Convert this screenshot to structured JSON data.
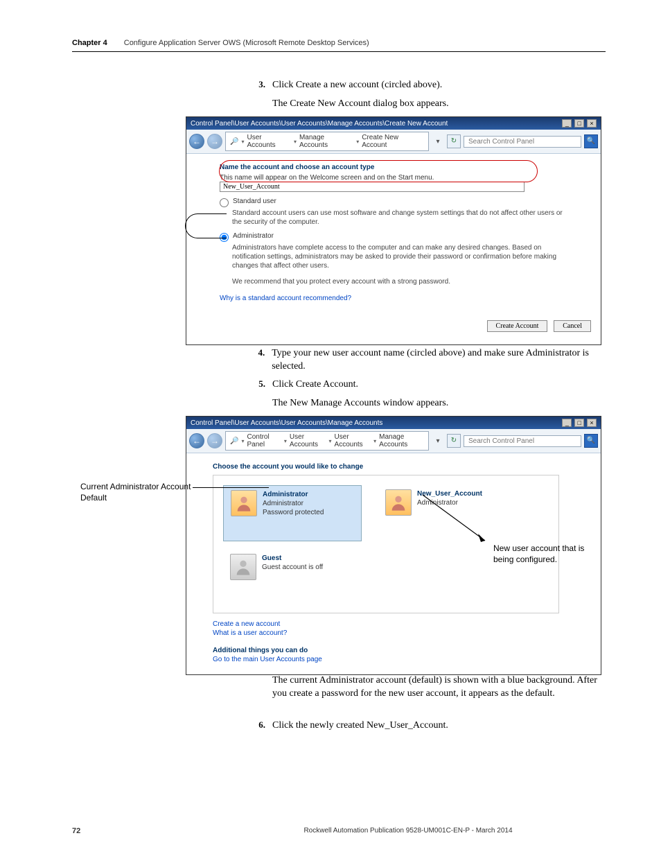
{
  "header": {
    "chapter": "Chapter 4",
    "title": "Configure Application Server OWS (Microsoft Remote Desktop Services)"
  },
  "steps": {
    "s3": {
      "num": "3.",
      "text": "Click Create a new account (circled above).",
      "sub": "The Create New Account dialog box appears."
    },
    "s4": {
      "num": "4.",
      "text": "Type your new user account name (circled above) and make sure Administrator is selected."
    },
    "s5": {
      "num": "5.",
      "text": "Click Create Account.",
      "sub": "The New Manage Accounts window appears."
    },
    "p_after": "The current Administrator account (default) is shown with a blue background. After you create a password for the new user account, it appears as the default.",
    "s6": {
      "num": "6.",
      "text": "Click the newly created New_User_Account."
    }
  },
  "win1": {
    "title": "Control Panel\\User Accounts\\User Accounts\\Manage Accounts\\Create New Account",
    "bc": [
      "User Accounts",
      "Manage Accounts",
      "Create New Account"
    ],
    "search": "Search Control Panel",
    "head": "Name the account and choose an account type",
    "sub": "This name will appear on the Welcome screen and on the Start menu.",
    "input": "New_User_Account",
    "r1": "Standard user",
    "r1d": "Standard account users can use most software and change system settings that do not affect other users or the security of the computer.",
    "r2": "Administrator",
    "r2d": "Administrators have complete access to the computer and can make any desired changes. Based on notification settings, administrators may be asked to provide their password or confirmation before making changes that affect other users.",
    "r2d2": "We recommend that you protect every account with a strong password.",
    "link": "Why is a standard account recommended?",
    "btn_create": "Create Account",
    "btn_cancel": "Cancel"
  },
  "win2": {
    "title": "Control Panel\\User Accounts\\User Accounts\\Manage Accounts",
    "bc": [
      "Control Panel",
      "User Accounts",
      "User Accounts",
      "Manage Accounts"
    ],
    "search": "Search Control Panel",
    "head": "Choose the account you would like to change",
    "acct1": {
      "name": "Administrator",
      "role": "Administrator",
      "status": "Password protected"
    },
    "acct2": {
      "name": "New_User_Account",
      "role": "Administrator"
    },
    "acct3": {
      "name": "Guest",
      "role": "Guest account is off"
    },
    "link1": "Create a new account",
    "link2": "What is a user account?",
    "addl": "Additional things you can do",
    "link3": "Go to the main User Accounts page"
  },
  "annot": {
    "left": "Current Administrator Account Default",
    "right": "New user account that is being configured."
  },
  "footer": {
    "page": "72",
    "pub": "Rockwell Automation Publication 9528-UM001C-EN-P - March 2014"
  }
}
